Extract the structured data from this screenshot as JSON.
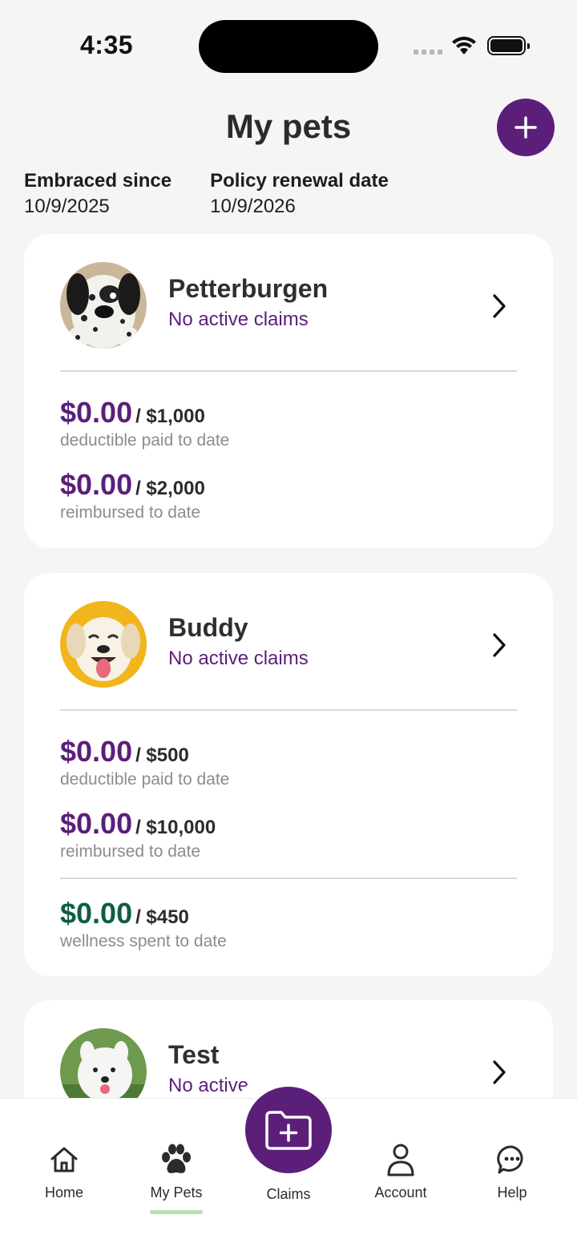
{
  "status_bar": {
    "time": "4:35"
  },
  "header": {
    "title": "My pets"
  },
  "policy": {
    "embraced_label": "Embraced since",
    "embraced_value": "10/9/2025",
    "renewal_label": "Policy renewal date",
    "renewal_value": "10/9/2026"
  },
  "pets": [
    {
      "name": "Petterburgen",
      "claims_status": "No active claims",
      "deductible_paid": "$0.00",
      "deductible_limit": "/ $1,000",
      "deductible_label": "deductible paid to date",
      "reimbursed": "$0.00",
      "reimbursed_limit": "/ $2,000",
      "reimbursed_label": "reimbursed to date"
    },
    {
      "name": "Buddy",
      "claims_status": "No active claims",
      "deductible_paid": "$0.00",
      "deductible_limit": "/ $500",
      "deductible_label": "deductible paid to date",
      "reimbursed": "$0.00",
      "reimbursed_limit": "/ $10,000",
      "reimbursed_label": "reimbursed to date",
      "wellness_spent": "$0.00",
      "wellness_limit": "/ $450",
      "wellness_label": "wellness spent to date"
    },
    {
      "name": "Test",
      "claims_status": "No active claims"
    }
  ],
  "nav": {
    "home": "Home",
    "my_pets": "My Pets",
    "claims": "Claims",
    "account": "Account",
    "help": "Help",
    "active": "my_pets"
  },
  "colors": {
    "brand_purple": "#5b1f7a",
    "wellness_green": "#0e5e3f",
    "active_indicator": "#b7e0b3"
  }
}
